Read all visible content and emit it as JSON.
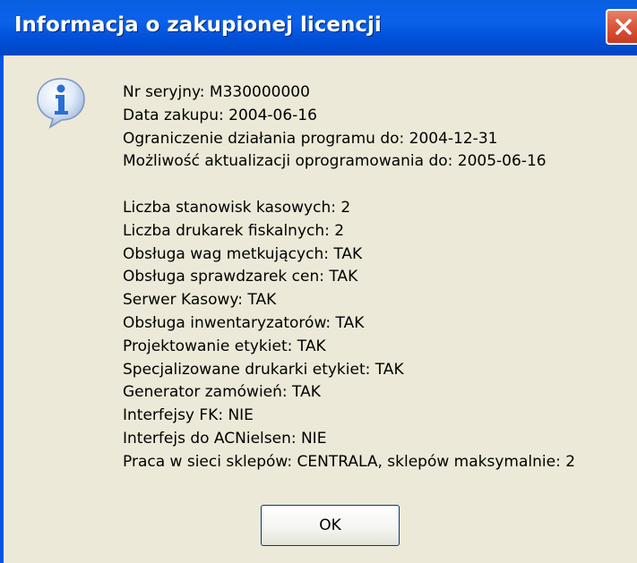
{
  "window": {
    "title": "Informacja o zakupionej licencji",
    "close_icon": "close-icon"
  },
  "icon": {
    "name": "information-icon",
    "glyph": "i"
  },
  "info": {
    "lines": [
      "Nr seryjny: M330000000",
      "Data zakupu: 2004-06-16",
      "Ograniczenie działania programu do: 2004-12-31",
      "Możliwość aktualizacji oprogramowania do: 2005-06-16",
      "",
      "Liczba stanowisk kasowych: 2",
      "Liczba drukarek fiskalnych: 2",
      "Obsługa wag metkujących: TAK",
      "Obsługa sprawdzarek cen: TAK",
      "Serwer Kasowy: TAK",
      "Obsługa inwentaryzatorów: TAK",
      "Projektowanie etykiet: TAK",
      "Specjalizowane drukarki etykiet: TAK",
      "Generator zamówień: TAK",
      "Interfejsy FK: NIE",
      "Interfejs do ACNielsen: NIE",
      "Praca w sieci sklepów: CENTRALA, sklepów maksymalnie: 2"
    ]
  },
  "buttons": {
    "ok_label": "OK"
  },
  "colors": {
    "titlebar": "#0b61ea",
    "close_button": "#d9563c",
    "dialog_background": "#ece9d8",
    "icon_blue": "#2a6fd6"
  }
}
